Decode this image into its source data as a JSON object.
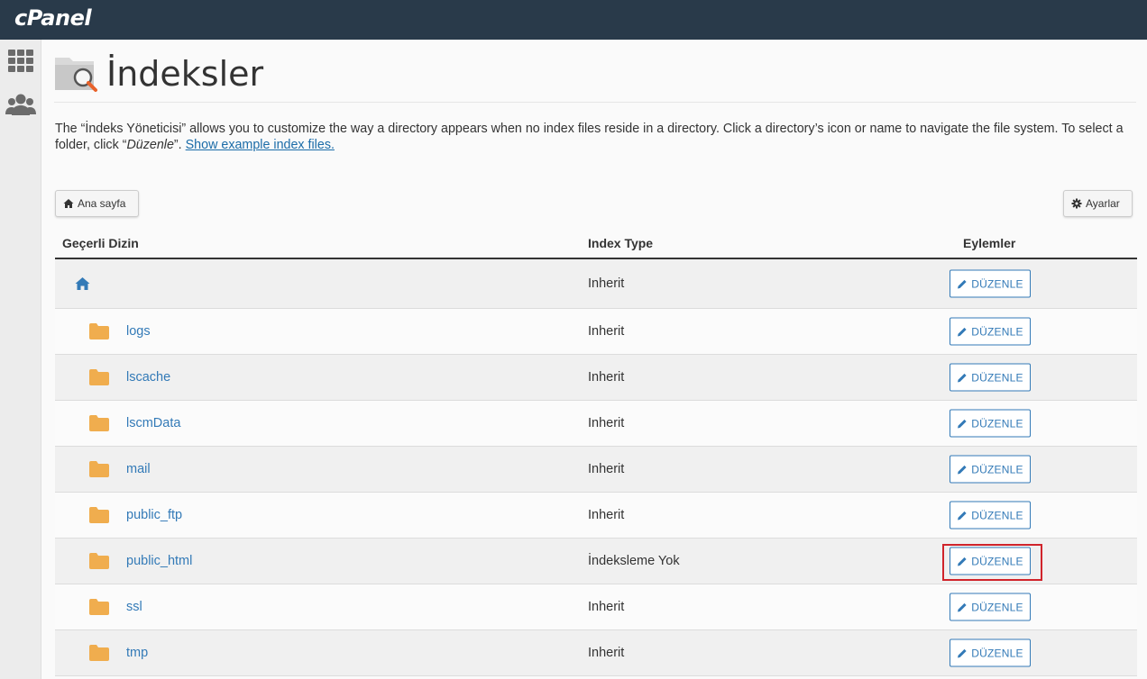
{
  "app": {
    "logo": "cPanel"
  },
  "page": {
    "title": "İndeksler"
  },
  "description": {
    "part1": "The “İndeks Yöneticisi” allows you to customize the way a directory appears when no index files reside in a directory. Click a directory’s icon or name to navigate the file system. To select a folder, click “",
    "emph": "Düzenle",
    "part2": "”. ",
    "link": "Show example index files."
  },
  "toolbar": {
    "home_label": "Ana sayfa",
    "settings_label": "Ayarlar"
  },
  "table": {
    "headers": {
      "dir": "Geçerli Dizin",
      "type": "Index Type",
      "actions": "Eylemler"
    },
    "edit_label": "DÜZENLE",
    "rows": [
      {
        "name": "",
        "type": "Inherit"
      },
      {
        "name": "logs",
        "type": "Inherit"
      },
      {
        "name": "lscache",
        "type": "Inherit"
      },
      {
        "name": "lscmData",
        "type": "Inherit"
      },
      {
        "name": "mail",
        "type": "Inherit"
      },
      {
        "name": "public_ftp",
        "type": "Inherit"
      },
      {
        "name": "public_html",
        "type": "İndeksleme Yok",
        "highlighted": true
      },
      {
        "name": "ssl",
        "type": "Inherit"
      },
      {
        "name": "tmp",
        "type": "Inherit"
      }
    ]
  },
  "colors": {
    "topbar": "#293a4a",
    "link": "#337ab7",
    "folder": "#f0ad4e",
    "highlight": "#d0242b"
  }
}
